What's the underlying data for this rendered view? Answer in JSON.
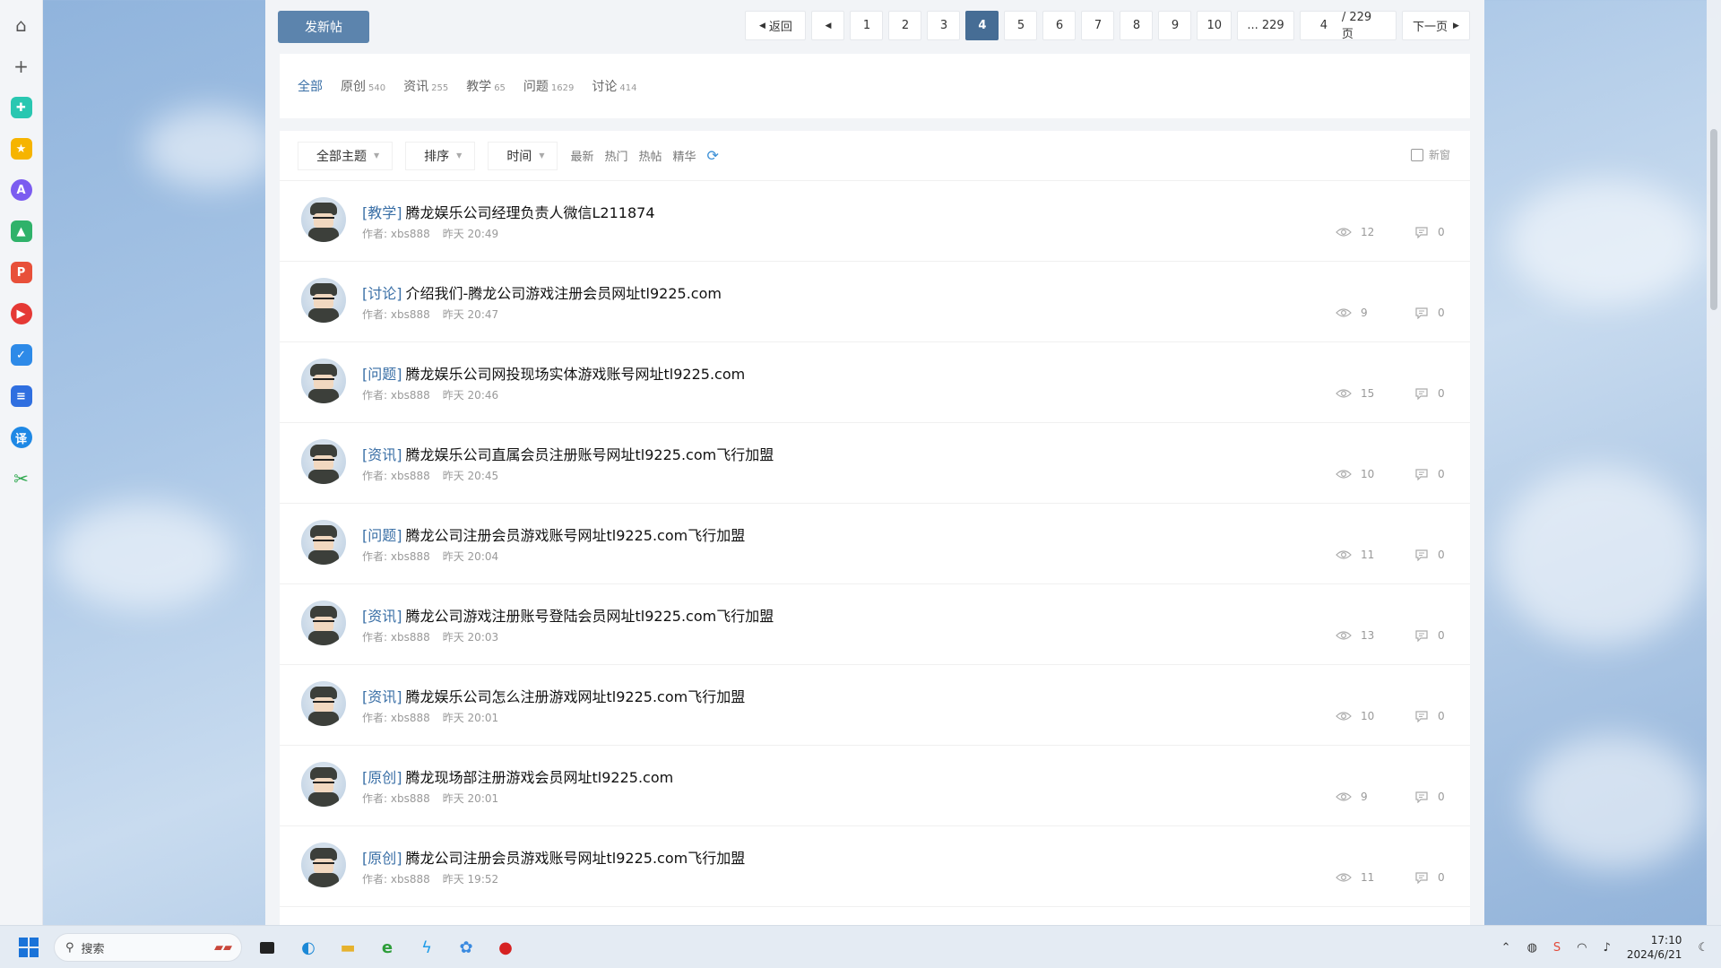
{
  "colors": {
    "accent": "#466d95",
    "button": "#5c84ad",
    "tag": "#3a6fa6",
    "refresh": "#3a8fd6"
  },
  "toolbar": {
    "new_post_label": "发新帖"
  },
  "pagination": {
    "back_label": "返回",
    "pages": [
      "1",
      "2",
      "3",
      "4",
      "5",
      "6",
      "7",
      "8",
      "9",
      "10"
    ],
    "current_page": "4",
    "last_label": "... 229",
    "page_input_value": "4",
    "total_label": "/ 229 页",
    "next_label": "下一页"
  },
  "categories": [
    {
      "label": "全部",
      "count": ""
    },
    {
      "label": "原创",
      "count": "540"
    },
    {
      "label": "资讯",
      "count": "255"
    },
    {
      "label": "教学",
      "count": "65"
    },
    {
      "label": "问题",
      "count": "1629"
    },
    {
      "label": "讨论",
      "count": "414"
    }
  ],
  "filters": {
    "all_topics": "全部主题",
    "sort": "排序",
    "time": "时间",
    "latest": "最新",
    "hot": "热门",
    "hot_posts": "热帖",
    "digest": "精华",
    "new_window": "新窗"
  },
  "threads": [
    {
      "tag": "[教学]",
      "title": "腾龙娱乐公司经理负责人微信L211874",
      "author": "作者: xbs888",
      "time": "昨天 20:49",
      "views": "12",
      "replies": "0"
    },
    {
      "tag": "[讨论]",
      "title": "介绍我们-腾龙公司游戏注册会员网址tl9225.com",
      "author": "作者: xbs888",
      "time": "昨天 20:47",
      "views": "9",
      "replies": "0"
    },
    {
      "tag": "[问题]",
      "title": "腾龙娱乐公司网投现场实体游戏账号网址tl9225.com",
      "author": "作者: xbs888",
      "time": "昨天 20:46",
      "views": "15",
      "replies": "0"
    },
    {
      "tag": "[资讯]",
      "title": "腾龙娱乐公司直属会员注册账号网址tl9225.com飞行加盟",
      "author": "作者: xbs888",
      "time": "昨天 20:45",
      "views": "10",
      "replies": "0"
    },
    {
      "tag": "[问题]",
      "title": "腾龙公司注册会员游戏账号网址tl9225.com飞行加盟",
      "author": "作者: xbs888",
      "time": "昨天 20:04",
      "views": "11",
      "replies": "0"
    },
    {
      "tag": "[资讯]",
      "title": "腾龙公司游戏注册账号登陆会员网址tl9225.com飞行加盟",
      "author": "作者: xbs888",
      "time": "昨天 20:03",
      "views": "13",
      "replies": "0"
    },
    {
      "tag": "[资讯]",
      "title": "腾龙娱乐公司怎么注册游戏网址tl9225.com飞行加盟",
      "author": "作者: xbs888",
      "time": "昨天 20:01",
      "views": "10",
      "replies": "0"
    },
    {
      "tag": "[原创]",
      "title": "腾龙现场部注册游戏会员网址tl9225.com",
      "author": "作者: xbs888",
      "time": "昨天 20:01",
      "views": "9",
      "replies": "0"
    },
    {
      "tag": "[原创]",
      "title": "腾龙公司注册会员游戏账号网址tl9225.com飞行加盟",
      "author": "作者: xbs888",
      "time": "昨天 19:52",
      "views": "11",
      "replies": "0"
    }
  ],
  "sidebar_icons": [
    "home-icon",
    "plus-icon",
    "medical-cross-icon",
    "star-icon",
    "ai-assistant-icon",
    "ai-image-icon",
    "ai-pdf-icon",
    "ai-video-icon",
    "ai-chart-icon",
    "ai-document-icon",
    "translate-icon",
    "scissors-icon"
  ],
  "taskbar": {
    "search_placeholder": "搜索",
    "time": "17:10",
    "date": "2024/6/21"
  }
}
